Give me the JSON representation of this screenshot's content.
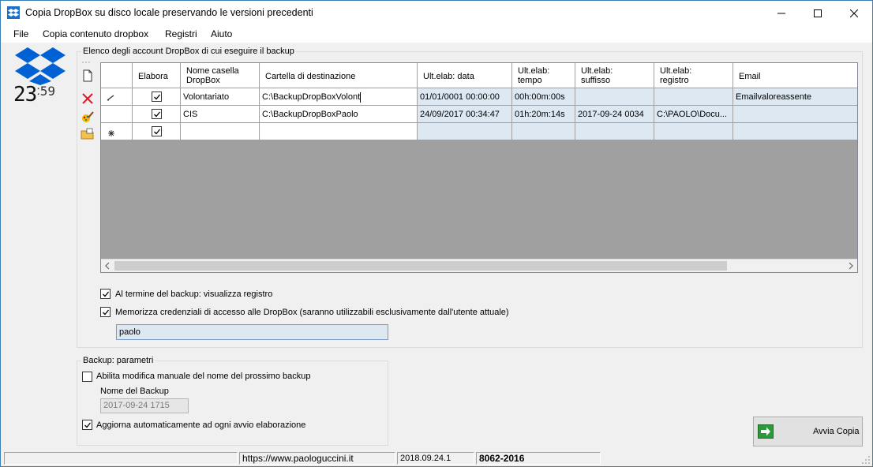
{
  "window": {
    "title": "Copia DropBox su disco locale preservando le versioni precedenti"
  },
  "menu": [
    "File",
    "Copia contenuto dropbox",
    "Registri",
    "Aiuto"
  ],
  "logo": {
    "clock_hours": "23",
    "clock_minutes": "59"
  },
  "accounts_group": {
    "label": "Elenco degli account DropBox di cui eseguire il backup",
    "columns": [
      {
        "l1": "Elabora",
        "l2": ""
      },
      {
        "l1": "Nome casella",
        "l2": "DropBox"
      },
      {
        "l1": "Cartella di destinazione",
        "l2": ""
      },
      {
        "l1": "Ult.elab: data",
        "l2": ""
      },
      {
        "l1": "Ult.elab:",
        "l2": "tempo"
      },
      {
        "l1": "Ult.elab:",
        "l2": "suffisso"
      },
      {
        "l1": "Ult.elab:",
        "l2": "registro"
      },
      {
        "l1": "Email",
        "l2": ""
      }
    ],
    "rows": [
      {
        "elabora": true,
        "nome": "Volontariato",
        "cartella": "C:\\BackupDropBoxVolont",
        "data": "01/01/0001 00:00:00",
        "tempo": "00h:00m:00s",
        "suffisso": "",
        "registro": "",
        "email": "Emailvaloreassente"
      },
      {
        "elabora": true,
        "nome": "CIS",
        "cartella": "C:\\BackupDropBoxPaolo",
        "data": "24/09/2017 00:34:47",
        "tempo": "01h:20m:14s",
        "suffisso": "2017-09-24 0034",
        "registro": "C:\\PAOLO\\Docu...",
        "email": ""
      },
      {
        "elabora": true,
        "nome": "",
        "cartella": "",
        "data": "",
        "tempo": "",
        "suffisso": "",
        "registro": "",
        "email": ""
      }
    ],
    "show_log_label": "Al termine del backup: visualizza registro",
    "show_log_checked": true,
    "store_credentials_label": "Memorizza credenziali di accesso alle DropBox (saranno utilizzabili esclusivamente dall'utente attuale)",
    "store_credentials_checked": true,
    "user_value": "paolo"
  },
  "backup_group": {
    "label": "Backup: parametri",
    "manual_name_label": "Abilita modifica manuale del nome del prossimo backup",
    "manual_name_checked": false,
    "backup_name_label": "Nome del Backup",
    "backup_name_value": "2017-09-24 1715",
    "auto_update_label": "Aggiorna automaticamente ad ogni avvio elaborazione",
    "auto_update_checked": true
  },
  "start_button": {
    "label": "Avvia Copia"
  },
  "statusbar": {
    "panel1": "",
    "website": "https://www.paologuccini.it",
    "version": "2018.09.24.1",
    "code": "8062-2016"
  },
  "colors": {
    "readonly_cell": "#dde8f2",
    "grid_background": "#a0a0a0",
    "dropbox_blue": "#0061d5",
    "delete_red": "#e81123"
  }
}
